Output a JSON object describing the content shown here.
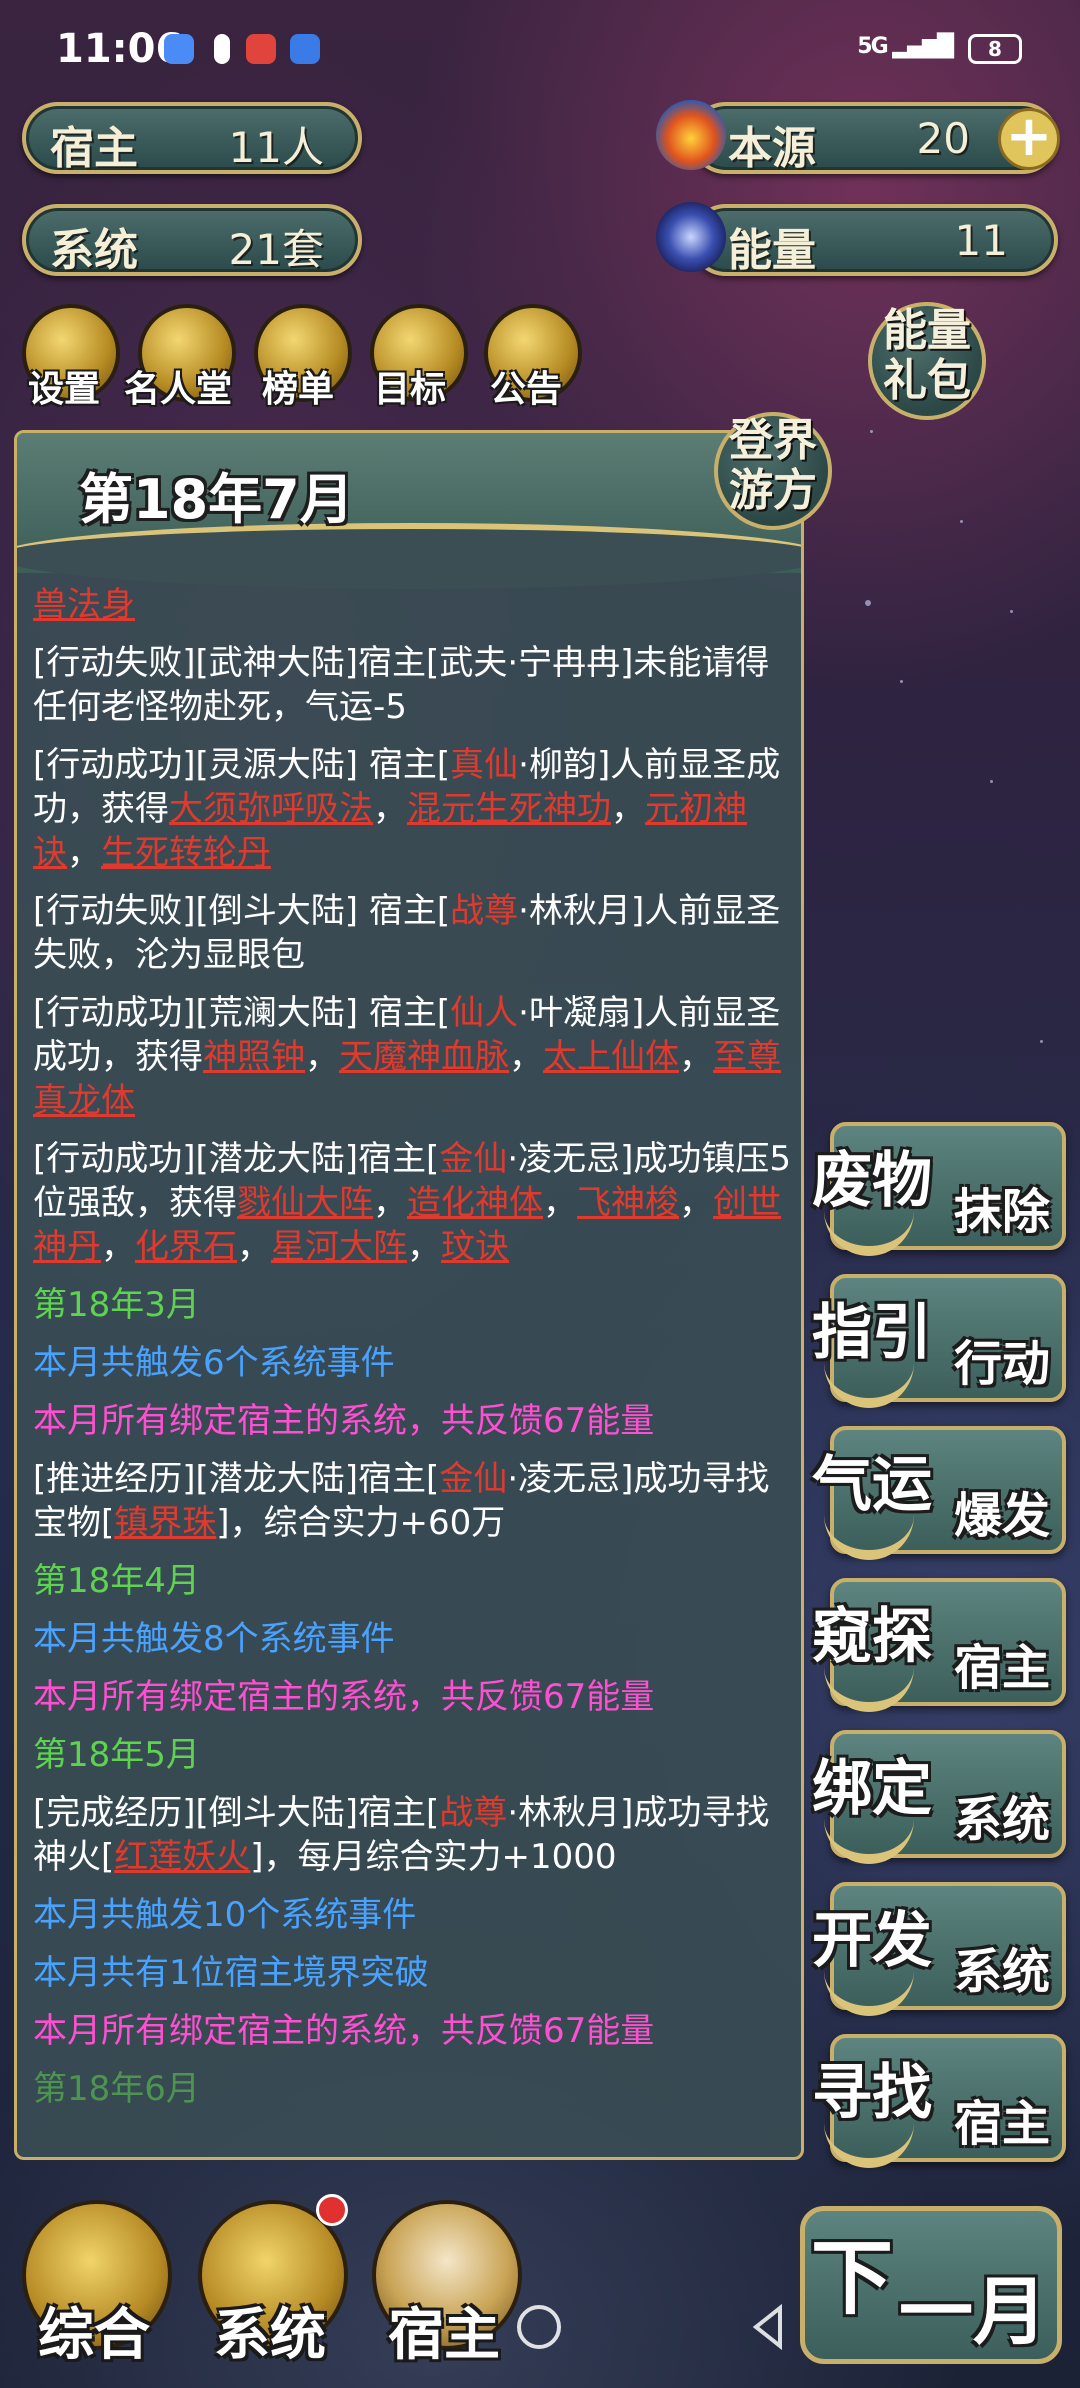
{
  "status_bar": {
    "time": "11:06",
    "signal": "5G",
    "battery": "8"
  },
  "resources": {
    "host": {
      "label": "宿主",
      "value": "11人"
    },
    "system": {
      "label": "系统",
      "value": "21套"
    },
    "origin": {
      "label": "本源",
      "value": "20"
    },
    "energy": {
      "label": "能量",
      "value": "11"
    }
  },
  "top_icons": [
    {
      "label": "设置",
      "icon": "gear-icon"
    },
    {
      "label": "名人堂",
      "icon": "hall-icon"
    },
    {
      "label": "榜单",
      "icon": "ranking-icon"
    },
    {
      "label": "目标",
      "icon": "target-icon"
    },
    {
      "label": "公告",
      "icon": "announcement-icon"
    }
  ],
  "energy_pack": {
    "line1": "能量",
    "line2": "礼包"
  },
  "realm_travel": {
    "line1": "登界",
    "line2": "游方"
  },
  "log_panel": {
    "date_title": "第18年7月",
    "first_line": "兽法身",
    "e1": "[行动失败][武神大陆]宿主[武夫·宁冉冉]未能请得任何老怪物赴死，气运-5",
    "e2_pre": "[行动成功][灵源大陆] 宿主[",
    "e2_rank": "真仙",
    "e2_mid": "·柳韵]人前显圣成功，获得",
    "e2_i1": "大须弥呼吸法",
    "e2_i2": "混元生死神功",
    "e2_i3": "元初神诀",
    "e2_i4": "生死转轮丹",
    "sep": "，",
    "e3_pre": "[行动失败][倒斗大陆] 宿主[",
    "e3_rank": "战尊",
    "e3_post": "·林秋月]人前显圣失败，沦为显眼包",
    "e4_pre": "[行动成功][荒澜大陆] 宿主[",
    "e4_rank": "仙人",
    "e4_mid": "·叶凝扇]人前显圣成功，获得",
    "e4_i1": "神照钟",
    "e4_i2": "天魔神血脉",
    "e4_i3": "太上仙体",
    "e4_i4": "至尊真龙体",
    "e5_pre": "[行动成功][潜龙大陆]宿主[",
    "e5_rank": "金仙",
    "e5_mid": "·凌无忌]成功镇压5位强敌，获得",
    "e5_i1": "戮仙大阵",
    "e5_i2": "造化神体",
    "e5_i3": "飞神梭",
    "e5_i4": "创世神丹",
    "e5_i5": "化界石",
    "e5_i6": "星河大阵",
    "e5_i7": "玟诀",
    "m3": "第18年3月",
    "m3_events": "本月共触发6个系统事件",
    "m3_energy": "本月所有绑定宿主的系统，共反馈67能量",
    "e6_pre": "[推进经历][潜龙大陆]宿主[",
    "e6_rank": "金仙",
    "e6_mid": "·凌无忌]成功寻找宝物[",
    "e6_item": "镇界珠",
    "e6_post": "]，综合实力+60万",
    "m4": "第18年4月",
    "m4_events": "本月共触发8个系统事件",
    "m4_energy": "本月所有绑定宿主的系统，共反馈67能量",
    "m5": "第18年5月",
    "e7_pre": "[完成经历][倒斗大陆]宿主[",
    "e7_rank": "战尊",
    "e7_mid": "·林秋月]成功寻找神火[",
    "e7_item": "红莲妖火",
    "e7_post": "]，每月综合实力+1000",
    "m5_events": "本月共触发10个系统事件",
    "m5_break": "本月共有1位宿主境界突破",
    "m5_energy": "本月所有绑定宿主的系统，共反馈67能量",
    "m6_partial": "第18年6月"
  },
  "actions": [
    {
      "line1": "废物",
      "line2": "抹除"
    },
    {
      "line1": "指引",
      "line2": "行动"
    },
    {
      "line1": "气运",
      "line2": "爆发"
    },
    {
      "line1": "窥探",
      "line2": "宿主"
    },
    {
      "line1": "绑定",
      "line2": "系统"
    },
    {
      "line1": "开发",
      "line2": "系统"
    },
    {
      "line1": "寻找",
      "line2": "宿主"
    }
  ],
  "bottom_nav": {
    "overview": "综合",
    "system": "系统",
    "host": "宿主",
    "next_line1": "下",
    "next_line2": "一月"
  },
  "colors": {
    "gold_border": "#c9b06a",
    "panel_bg": "#3a4e54",
    "red_text": "#e03a2e",
    "green_text": "#5ed34f",
    "blue_text": "#4aa2ff",
    "magenta_text": "#ff4fd1"
  }
}
